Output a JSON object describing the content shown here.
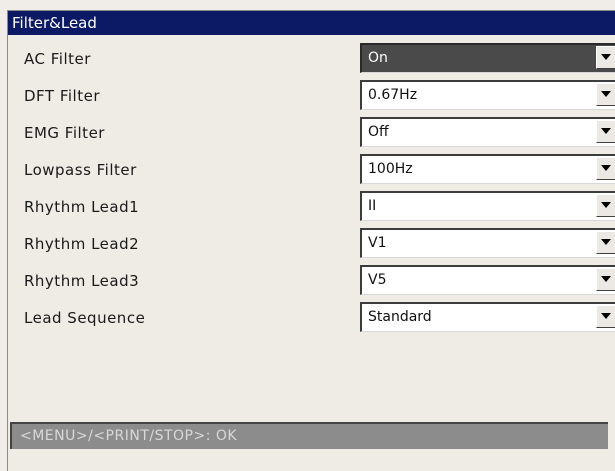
{
  "window": {
    "title": "Filter&Lead"
  },
  "settings": [
    {
      "label": "AC Filter",
      "value": "On"
    },
    {
      "label": "DFT Filter",
      "value": "0.67Hz"
    },
    {
      "label": "EMG Filter",
      "value": "Off"
    },
    {
      "label": "Lowpass Filter",
      "value": "100Hz"
    },
    {
      "label": "Rhythm Lead1",
      "value": "II"
    },
    {
      "label": "Rhythm Lead2",
      "value": "V1"
    },
    {
      "label": "Rhythm Lead3",
      "value": "V5"
    },
    {
      "label": "Lead Sequence",
      "value": "Standard"
    }
  ],
  "active_index": 0,
  "status": {
    "text": "<MENU>/<PRINT/STOP>: OK"
  },
  "colors": {
    "title_bar": "#0c1a66",
    "active_select": "#4a4a4a",
    "status_bar": "#8c8c8c",
    "background": "#efece6"
  },
  "icons": {
    "dropdown": "triangle-down-icon"
  }
}
